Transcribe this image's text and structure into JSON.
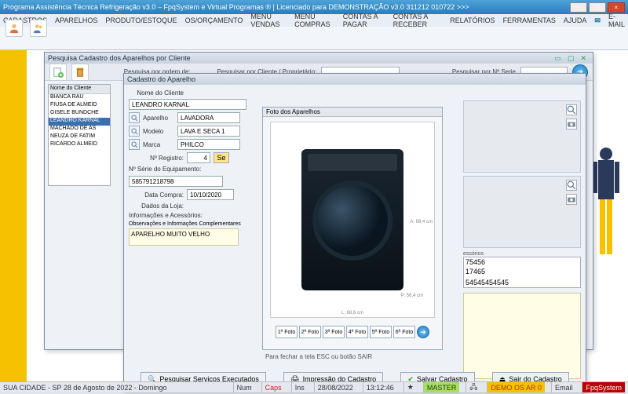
{
  "titlebar": "Programa Assistência Técnica Refrigeração v3.0 – FpqSystem e Virtual Programas ® | Licenciado para  DEMONSTRAÇÃO v3.0 311212 010722 >>>",
  "menu": [
    "CADASTROS",
    "APARELHOS",
    "PRODUTO/ESTOQUE",
    "OS/ORÇAMENTO",
    "MENU VENDAS",
    "MENU COMPRAS",
    "CONTAS A PAGAR",
    "CONTAS A RECEBER",
    "RELATÓRIOS",
    "FERRAMENTAS",
    "AJUDA",
    "E-MAIL"
  ],
  "toolbar_labels": [
    "Clientes",
    "Fornec"
  ],
  "search_window": {
    "title": "Pesquisa Cadastro dos Aparelhos por Cliente",
    "lbl_ordem": "Pesquisa por ordem de:",
    "lbl_cliente": "Pesquisar por Cliente / Proprietário:",
    "lbl_serie": "Pesquisar por Nº Serie"
  },
  "client_list": {
    "header": "Nome do Cliente",
    "rows": [
      "BIANCA RAU",
      "FIUSA DE ALMEID",
      "GISELE BUNDCHE",
      "LEANDRO KARNAL",
      "MACHADO DE AS",
      "NEUZA DE FATIM",
      "RICARDO ALMEID"
    ],
    "selected_index": 3
  },
  "cadastro": {
    "title": "Cadastro do Aparelho",
    "lbl_nome": "Nome do Cliente",
    "nome": "LEANDRO KARNAL",
    "lbl_aparelho": "Aparelho",
    "aparelho": "LAVADORA",
    "lbl_modelo": "Modelo",
    "modelo": "LAVA E SECA 1",
    "lbl_marca": "Marca",
    "marca": "PHILCO",
    "lbl_registro": "Nº Registro:",
    "registro": "4",
    "btn_se": "Se",
    "lbl_nserie": "Nº Série do Equipamento:",
    "nserie": "585791218798",
    "lbl_data": "Data Compra:",
    "data": "10/10/2020",
    "lbl_loja": "Dados da Loja:",
    "lbl_info": "Informações e Acessórios:",
    "lbl_obs": "Observações e Informações Complementares",
    "obs": "APARELHO MUITO VELHO",
    "buttons": {
      "servicos": "Pesquisar Serviços Executados",
      "impressao": "Impressão do Cadastro",
      "salvar": "Salvar Cadastro",
      "sair": "Sair do Cadastro"
    }
  },
  "acessorios": {
    "label": "essórios",
    "items": [
      "75456",
      "17465",
      "",
      "54545454545"
    ]
  },
  "photo": {
    "title": "Foto dos Aparelhos",
    "dim_h": "A: 98,4 cm",
    "dim_w": "L: 68,6 cm",
    "dim_d": "P: 56,4 cm",
    "buttons": [
      "1ª Foto",
      "2ª Foto",
      "3ª Foto",
      "4ª Foto",
      "5ª Foto",
      "6ª Foto"
    ]
  },
  "close_hint": "Para fechar a tela ESC ou botão SAIR",
  "status": {
    "city": "SUA CIDADE - SP 28 de Agosto de 2022 - Domingo",
    "num": "Num",
    "caps": "Caps",
    "ins": "Ins",
    "date": "28/08/2022",
    "time": "13:12:46",
    "master": "MASTER",
    "demo": "DEMO OS AR 0",
    "email": "Email",
    "brand": "FpqSystem"
  }
}
